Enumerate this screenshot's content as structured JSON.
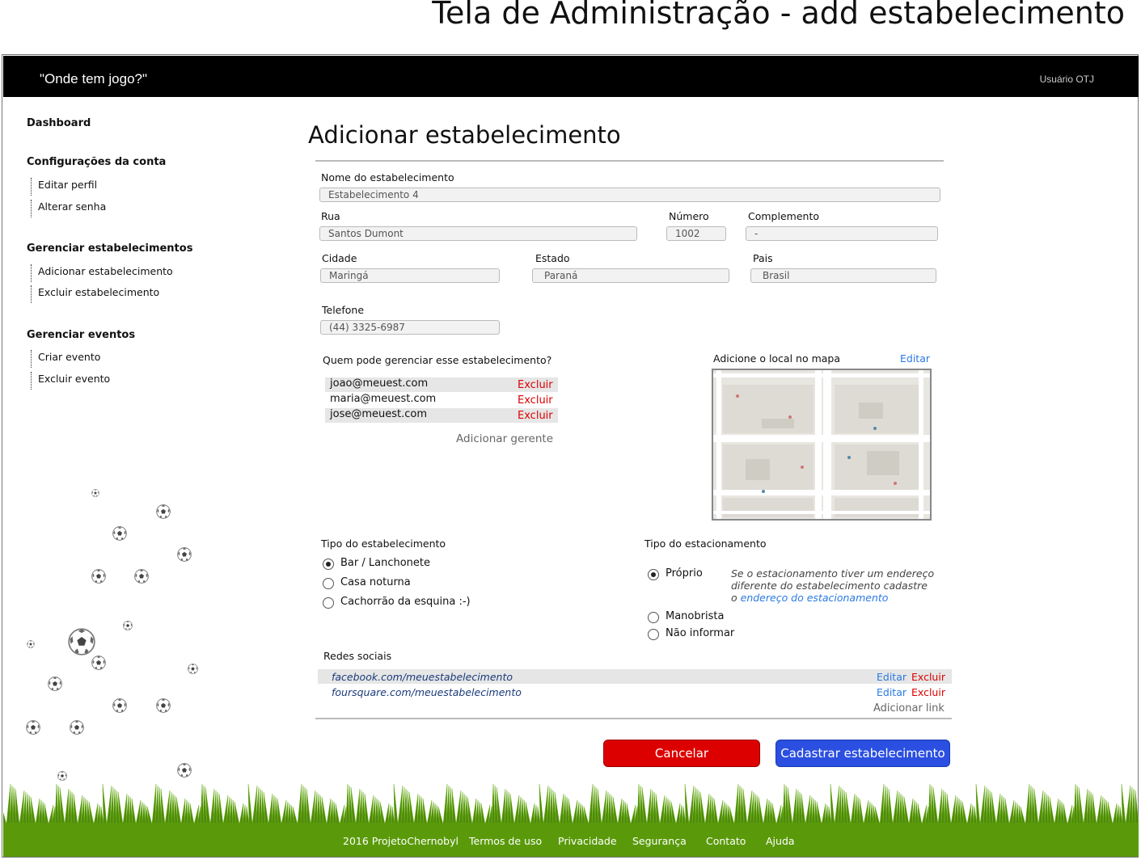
{
  "mockup_title": "Tela de Administração - add estabelecimento",
  "header": {
    "brand": "\"Onde tem jogo?\"",
    "user": "Usuário OTJ"
  },
  "sidebar": {
    "dashboard": "Dashboard",
    "sections": [
      {
        "title": "Configurações da conta",
        "items": [
          "Editar perfil",
          "Alterar senha"
        ]
      },
      {
        "title": "Gerenciar estabelecimentos",
        "items": [
          "Adicionar estabelecimento",
          "Excluir estabelecimento"
        ]
      },
      {
        "title": "Gerenciar eventos",
        "items": [
          "Criar evento",
          "Excluir evento"
        ]
      }
    ]
  },
  "main": {
    "title": "Adicionar estabelecimento",
    "fields": {
      "nome": {
        "label": "Nome do estabelecimento",
        "value": "Estabelecimento 4"
      },
      "rua": {
        "label": "Rua",
        "value": "Santos Dumont"
      },
      "numero": {
        "label": "Número",
        "value": "1002"
      },
      "complemento": {
        "label": "Complemento",
        "value": "-"
      },
      "cidade": {
        "label": "Cidade",
        "value": "Maringá"
      },
      "estado": {
        "label": "Estado",
        "value": "Paraná"
      },
      "pais": {
        "label": "Pais",
        "value": "Brasil"
      },
      "telefone": {
        "label": "Telefone",
        "value": "(44) 3325-6987"
      }
    },
    "managers": {
      "label": "Quem pode gerenciar esse estabelecimento?",
      "items": [
        {
          "email": "joao@meuest.com",
          "action": "Excluir"
        },
        {
          "email": "maria@meuest.com",
          "action": "Excluir"
        },
        {
          "email": "jose@meuest.com",
          "action": "Excluir"
        }
      ],
      "add": "Adicionar gerente"
    },
    "map": {
      "label": "Adicione o local no mapa",
      "edit": "Editar"
    },
    "tipo_estabelecimento": {
      "label": "Tipo do estabelecimento",
      "options": [
        "Bar / Lanchonete",
        "Casa noturna",
        "Cachorrão da esquina :-)"
      ],
      "selected": 0
    },
    "tipo_estacionamento": {
      "label": "Tipo do estacionamento",
      "options": [
        "Próprio",
        "Manobrista",
        "Não informar"
      ],
      "selected": 0,
      "note_line1": "Se o estacionamento tiver um endereço",
      "note_line2": "diferente do estabelecimento cadastre",
      "note_prefix": "o ",
      "note_link": "endereço do estacionamento"
    },
    "redes": {
      "label": "Redes sociais",
      "items": [
        {
          "url": "facebook.com/meuestabelecimento",
          "edit": "Editar",
          "delete": "Excluir"
        },
        {
          "url": "foursquare.com/meuestabelecimento",
          "edit": "Editar",
          "delete": "Excluir"
        }
      ],
      "add": "Adicionar link"
    },
    "buttons": {
      "cancel": "Cancelar",
      "submit": "Cadastrar estabelecimento"
    }
  },
  "footer": [
    "2016 ProjetoChernobyl",
    "Termos de uso",
    "Privacidade",
    "Segurança",
    "Contato",
    "Ajuda"
  ],
  "colors": {
    "cancel": "#dd0000",
    "submit": "#2b4fe0",
    "footer_green": "#5a9a0a",
    "link_blue": "#2a7ae2",
    "delete_red": "#dd0000"
  },
  "icons": [
    "soccer-ball-icon",
    "radio-icon"
  ]
}
